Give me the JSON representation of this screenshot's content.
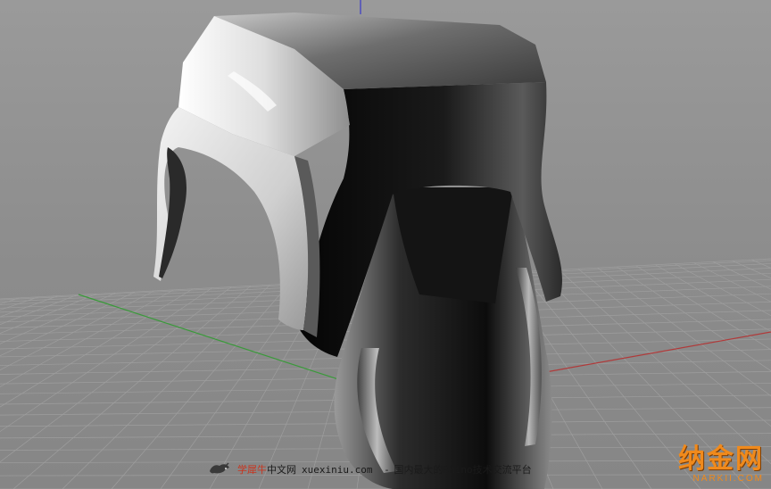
{
  "viewport": {
    "background": "#8c8c8c",
    "grid_color": "#9e9e9e",
    "x_axis_color": "#b03a3a",
    "y_axis_color": "#3a9a3a",
    "z_axis_color": "#3a3ac8"
  },
  "watermark": {
    "icon": "cow-logo-icon",
    "brand": "学犀牛",
    "brand_suffix": "中文网",
    "url": "xuexiniu.com",
    "separator": "-",
    "slogan": "国内最大的Rhino技术交流平台"
  },
  "site_logo": {
    "text": "纳金网",
    "subtext": "NARKII.COM",
    "color": "#f08a1c"
  }
}
